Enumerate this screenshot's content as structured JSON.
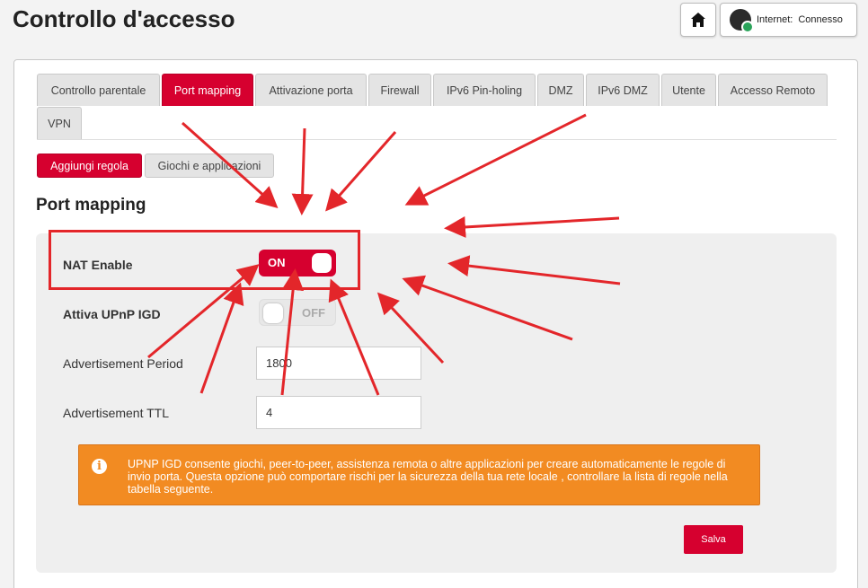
{
  "page": {
    "title": "Controllo d'accesso"
  },
  "header": {
    "internet_label": "Internet:",
    "internet_status": "Connesso"
  },
  "tabs": [
    {
      "label": "Controllo parentale",
      "active": false
    },
    {
      "label": "Port mapping",
      "active": true
    },
    {
      "label": "Attivazione porta",
      "active": false
    },
    {
      "label": "Firewall",
      "active": false
    },
    {
      "label": "IPv6 Pin-holing",
      "active": false
    },
    {
      "label": "DMZ",
      "active": false
    },
    {
      "label": "IPv6 DMZ",
      "active": false
    },
    {
      "label": "Utente",
      "active": false
    },
    {
      "label": "Accesso Remoto",
      "active": false
    },
    {
      "label": "VPN",
      "active": false
    }
  ],
  "subtabs": [
    {
      "label": "Aggiungi regola",
      "active": true
    },
    {
      "label": "Giochi e applicazioni",
      "active": false
    }
  ],
  "section": {
    "title": "Port mapping"
  },
  "settings": {
    "nat_enable": {
      "label": "NAT Enable",
      "state": "ON"
    },
    "upnp_igd": {
      "label": "Attiva UPnP IGD",
      "state": "OFF"
    },
    "adv_period": {
      "label": "Advertisement Period",
      "value": "1800"
    },
    "adv_ttl": {
      "label": "Advertisement TTL",
      "value": "4"
    }
  },
  "info": {
    "text": "UPNP IGD consente giochi, peer-to-peer, assistenza remota o altre applicazioni per creare automaticamente le regole di invio porta. Questa opzione può comportare rischi per la sicurezza della tua rete locale , controllare la lista di regole nella tabella seguente."
  },
  "buttons": {
    "save": "Salva"
  },
  "colors": {
    "accent": "#d6002f",
    "info_bg": "#f28b22",
    "annotation": "#e3262a"
  }
}
